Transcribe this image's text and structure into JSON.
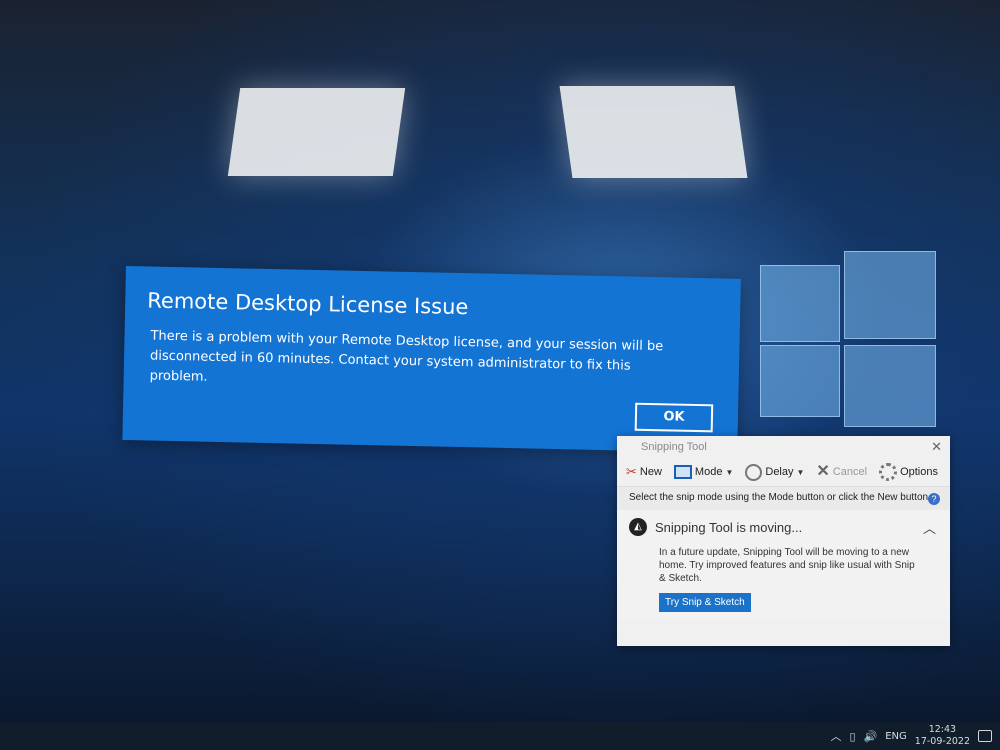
{
  "dialog": {
    "title": "Remote Desktop License Issue",
    "message": "There is a problem with your Remote Desktop license, and your session will be disconnected in 60 minutes. Contact your system administrator to fix this problem.",
    "ok_label": "OK"
  },
  "snipping_tool": {
    "title": "Snipping Tool",
    "toolbar": {
      "new_label": "New",
      "mode_label": "Mode",
      "delay_label": "Delay",
      "cancel_label": "Cancel",
      "options_label": "Options"
    },
    "hint": "Select the snip mode using the Mode button or click the New button.",
    "moving_title": "Snipping Tool is moving...",
    "moving_body": "In a future update, Snipping Tool will be moving to a new home. Try improved features and snip like usual with Snip & Sketch.",
    "try_button": "Try Snip & Sketch"
  },
  "taskbar": {
    "language": "ENG",
    "time": "12:43",
    "date": "17-09-2022"
  },
  "colors": {
    "dialog_bg": "#1474d4",
    "accent": "#1a73c9",
    "taskbar_bg": "#111d2b"
  }
}
